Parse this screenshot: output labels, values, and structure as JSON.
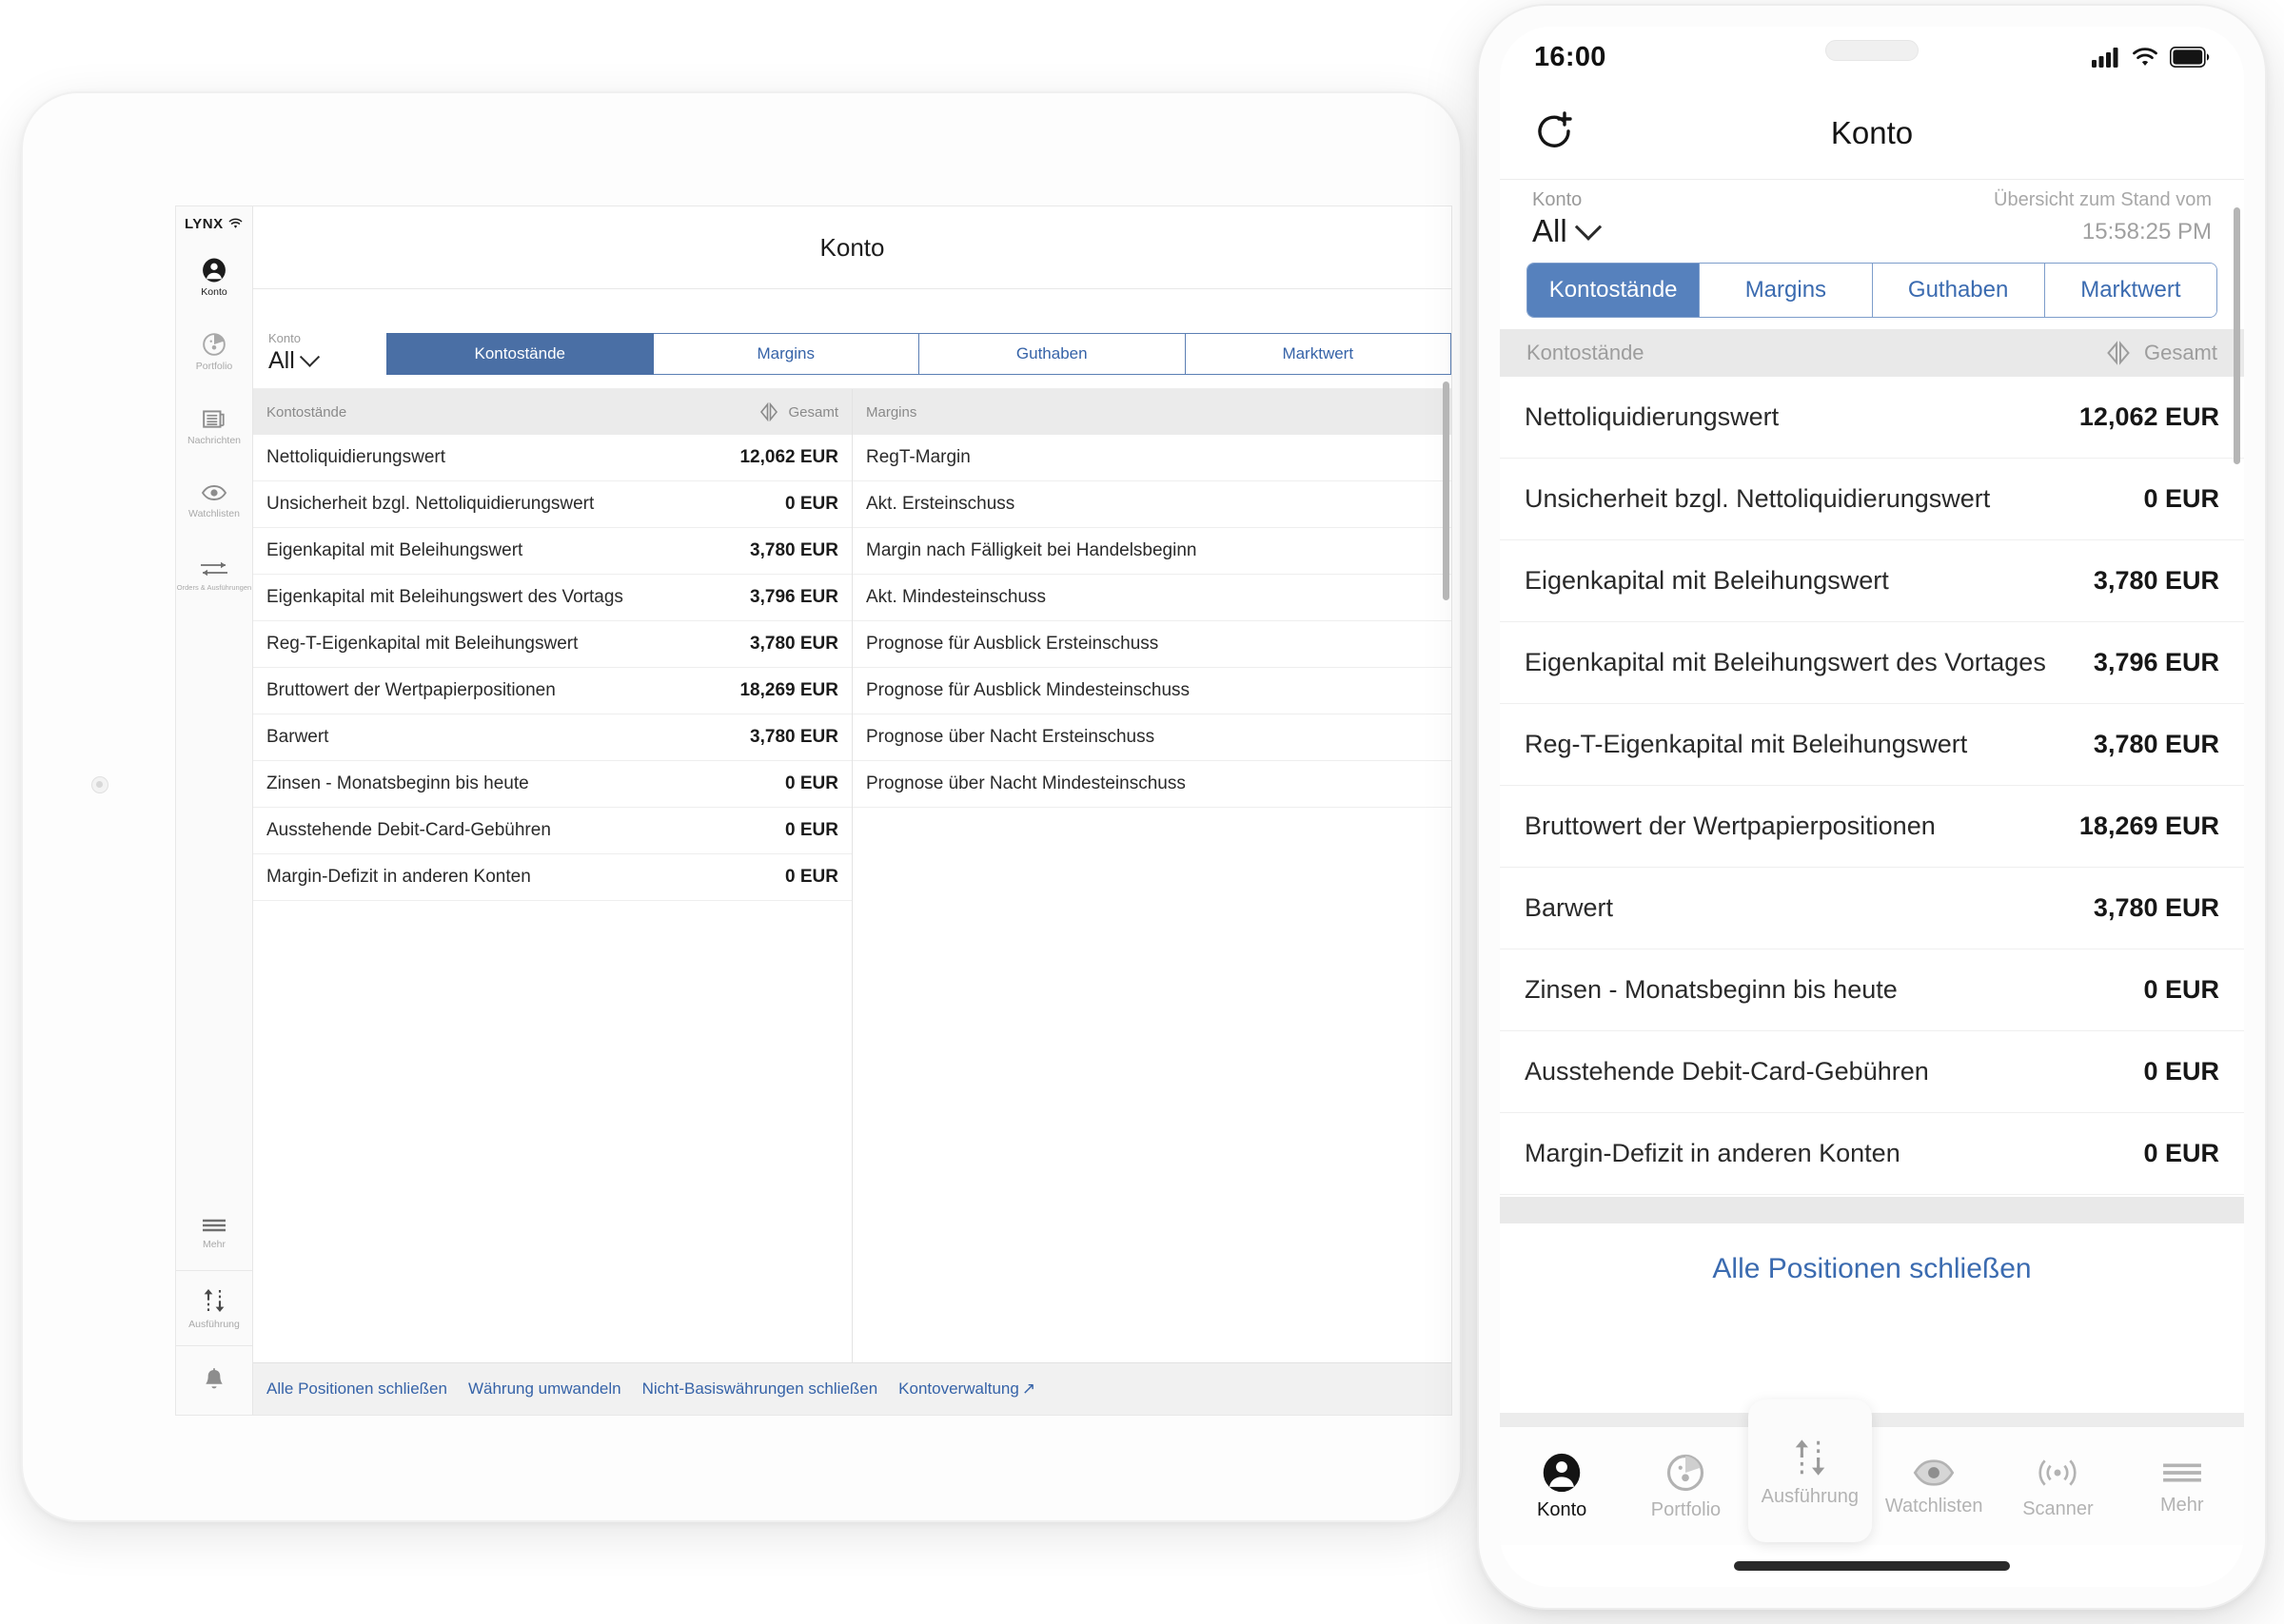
{
  "tablet": {
    "brand": "LYNX",
    "title": "Konto",
    "sidebar": {
      "items": [
        {
          "label": "Konto",
          "icon": "person-icon",
          "active": true
        },
        {
          "label": "Portfolio",
          "icon": "pie-chart-icon",
          "active": false
        },
        {
          "label": "Nachrichten",
          "icon": "news-icon",
          "active": false
        },
        {
          "label": "Watchlisten",
          "icon": "eye-icon",
          "active": false
        },
        {
          "label": "Orders & Ausführungen",
          "icon": "arrows-icon",
          "active": false
        }
      ],
      "bottom": [
        {
          "label": "Mehr",
          "icon": "hamburger-icon"
        },
        {
          "label": "Ausführung",
          "icon": "up-down-arrows-icon"
        }
      ],
      "bell": "bell-icon"
    },
    "account": {
      "caption": "Konto",
      "value": "All"
    },
    "tabs": [
      {
        "label": "Kontostände",
        "selected": true
      },
      {
        "label": "Margins",
        "selected": false
      },
      {
        "label": "Guthaben",
        "selected": false
      },
      {
        "label": "Marktwert",
        "selected": false
      }
    ],
    "columns": [
      {
        "header": "Kontostände",
        "total_label": "Gesamt",
        "rows": [
          {
            "label": "Nettoliquidierungswert",
            "value": "12,062 EUR"
          },
          {
            "label": "Unsicherheit bzgl. Nettoliquidierungswert",
            "value": "0 EUR"
          },
          {
            "label": "Eigenkapital mit Beleihungswert",
            "value": "3,780 EUR"
          },
          {
            "label": "Eigenkapital mit Beleihungswert des Vortags",
            "value": "3,796 EUR"
          },
          {
            "label": "Reg-T-Eigenkapital mit Beleihungswert",
            "value": "3,780 EUR"
          },
          {
            "label": "Bruttowert der Wertpapierpositionen",
            "value": "18,269 EUR"
          },
          {
            "label": "Barwert",
            "value": "3,780 EUR"
          },
          {
            "label": "Zinsen - Monatsbeginn bis heute",
            "value": "0 EUR"
          },
          {
            "label": "Ausstehende Debit-Card-Gebühren",
            "value": "0 EUR"
          },
          {
            "label": "Margin-Defizit in anderen Konten",
            "value": "0 EUR"
          }
        ]
      },
      {
        "header": "Margins",
        "total_label": "",
        "rows": [
          {
            "label": "RegT-Margin",
            "value": ""
          },
          {
            "label": "Akt. Ersteinschuss",
            "value": ""
          },
          {
            "label": "Margin nach Fälligkeit bei Handelsbeginn",
            "value": ""
          },
          {
            "label": "Akt. Mindesteinschuss",
            "value": ""
          },
          {
            "label": "Prognose für Ausblick Ersteinschuss",
            "value": ""
          },
          {
            "label": "Prognose für Ausblick Mindesteinschuss",
            "value": ""
          },
          {
            "label": "Prognose über Nacht Ersteinschuss",
            "value": ""
          },
          {
            "label": "Prognose über Nacht Mindesteinschuss",
            "value": ""
          }
        ]
      }
    ],
    "footer_links": [
      "Alle Positionen schließen",
      "Währung umwandeln",
      "Nicht-Basiswährungen schließen",
      "Kontoverwaltung"
    ]
  },
  "phone": {
    "status": {
      "time": "16:00",
      "signal": "cellular-bars-icon",
      "wifi": "wifi-icon",
      "battery": "battery-icon"
    },
    "navbar": {
      "left_icon": "refresh-plus-icon",
      "title": "Konto"
    },
    "account": {
      "caption": "Konto",
      "value": "All"
    },
    "timestamp": {
      "caption": "Übersicht zum Stand vom",
      "value": "15:58:25 PM"
    },
    "segments": [
      {
        "label": "Kontostände",
        "selected": true
      },
      {
        "label": "Margins",
        "selected": false
      },
      {
        "label": "Guthaben",
        "selected": false
      },
      {
        "label": "Marktwert",
        "selected": false
      }
    ],
    "colhead": {
      "title": "Kontostände",
      "total_label": "Gesamt"
    },
    "rows": [
      {
        "label": "Nettoliquidierungswert",
        "value": "12,062 EUR"
      },
      {
        "label": "Unsicherheit bzgl. Nettoliquidierungswert",
        "value": "0 EUR"
      },
      {
        "label": "Eigenkapital mit Beleihungswert",
        "value": "3,780 EUR"
      },
      {
        "label": "Eigenkapital mit Beleihungswert des Vortages",
        "value": "3,796 EUR"
      },
      {
        "label": "Reg-T-Eigenkapital mit Beleihungswert",
        "value": "3,780 EUR"
      },
      {
        "label": "Bruttowert der Wertpapierpositionen",
        "value": "18,269 EUR"
      },
      {
        "label": "Barwert",
        "value": "3,780 EUR"
      },
      {
        "label": "Zinsen - Monatsbeginn bis heute",
        "value": "0 EUR"
      },
      {
        "label": "Ausstehende Debit-Card-Gebühren",
        "value": "0 EUR"
      },
      {
        "label": "Margin-Defizit in anderen Konten",
        "value": "0 EUR"
      }
    ],
    "close_all_label": "Alle Positionen schließen",
    "tabbar": [
      {
        "label": "Konto",
        "icon": "person-icon",
        "active": true,
        "raised": false
      },
      {
        "label": "Portfolio",
        "icon": "pie-chart-icon",
        "active": false,
        "raised": false
      },
      {
        "label": "Ausführung",
        "icon": "up-down-arrows-icon",
        "active": false,
        "raised": true
      },
      {
        "label": "Watchlisten",
        "icon": "eye-icon",
        "active": false,
        "raised": false
      },
      {
        "label": "Scanner",
        "icon": "radar-icon",
        "active": false,
        "raised": false
      },
      {
        "label": "Mehr",
        "icon": "hamburger-icon",
        "active": false,
        "raised": false
      }
    ]
  },
  "colors": {
    "accent_blue": "#3663a8",
    "selected_tab_bg": "#4a6fa5",
    "segment_border": "#7d9dcb",
    "header_gray": "#e9e9e9"
  }
}
